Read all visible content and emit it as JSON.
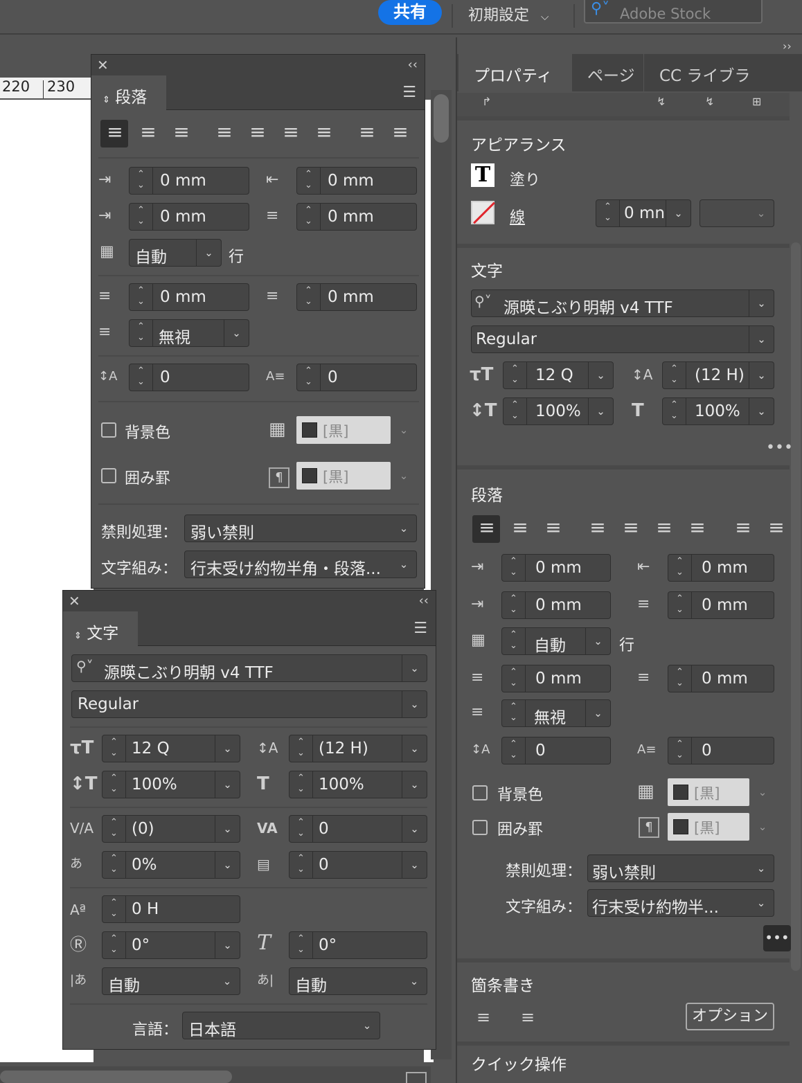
{
  "topbar": {
    "share_label": "共有",
    "workspace_label": "初期設定",
    "search_placeholder": "Adobe Stock"
  },
  "ruler": {
    "ticks": [
      "220",
      "230"
    ]
  },
  "paragraph_panel": {
    "tab_label": "段落",
    "left_indent": "0 mm",
    "right_indent": "0 mm",
    "first_line_indent": "0 mm",
    "last_line_indent": "0 mm",
    "grid_align": "自動",
    "grid_unit": "行",
    "space_before": "0 mm",
    "space_after": "0 mm",
    "align_to_grid": "無視",
    "dropcap_lines": "0",
    "dropcap_chars": "0",
    "shading_label": "背景色",
    "border_label": "囲み罫",
    "swatch_name": "[黒]",
    "kinsoku_label": "禁則処理：",
    "kinsoku_value": "弱い禁則",
    "mojikumi_label": "文字組み：",
    "mojikumi_value": "行末受け約物半角・段落..."
  },
  "character_panel": {
    "tab_label": "文字",
    "font": "源暎こぶり明朝 v4 TTF",
    "style": "Regular",
    "size": "12 Q",
    "leading": "(12 H)",
    "vertical_scale": "100%",
    "horizontal_scale": "100%",
    "kerning": "(0)",
    "tracking": "0",
    "tsume": "0%",
    "aki": "0",
    "baseline_shift": "0 H",
    "rotation": "0°",
    "skew": "0°",
    "aki_before": "自動",
    "aki_after": "自動",
    "language_label": "言語：",
    "language": "日本語"
  },
  "properties": {
    "tabs": [
      "プロパティ",
      "ページ",
      "CC ライブラ"
    ],
    "appearance": {
      "title": "アピアランス",
      "fill_label": "塗り",
      "stroke_label": "線",
      "stroke_weight": "0 mn"
    },
    "character": {
      "title": "文字",
      "font": "源暎こぶり明朝 v4 TTF",
      "style": "Regular",
      "size": "12 Q",
      "leading": "(12 H)",
      "vertical_scale": "100%",
      "horizontal_scale": "100%"
    },
    "paragraph": {
      "title": "段落",
      "left_indent": "0 mm",
      "right_indent": "0 mm",
      "first_line_indent": "0 mm",
      "last_line_indent": "0 mm",
      "grid_align": "自動",
      "grid_unit": "行",
      "space_before": "0 mm",
      "space_after": "0 mm",
      "align_to_grid": "無視",
      "dropcap_lines": "0",
      "dropcap_chars": "0",
      "shading_label": "背景色",
      "border_label": "囲み罫",
      "swatch_name": "[黒]",
      "kinsoku_label": "禁則処理：",
      "kinsoku_value": "弱い禁則",
      "mojikumi_label": "文字組み：",
      "mojikumi_value": "行末受け約物半..."
    },
    "bullets": {
      "title": "箇条書き",
      "options_label": "オプション"
    },
    "quick_actions_title": "クイック操作"
  }
}
